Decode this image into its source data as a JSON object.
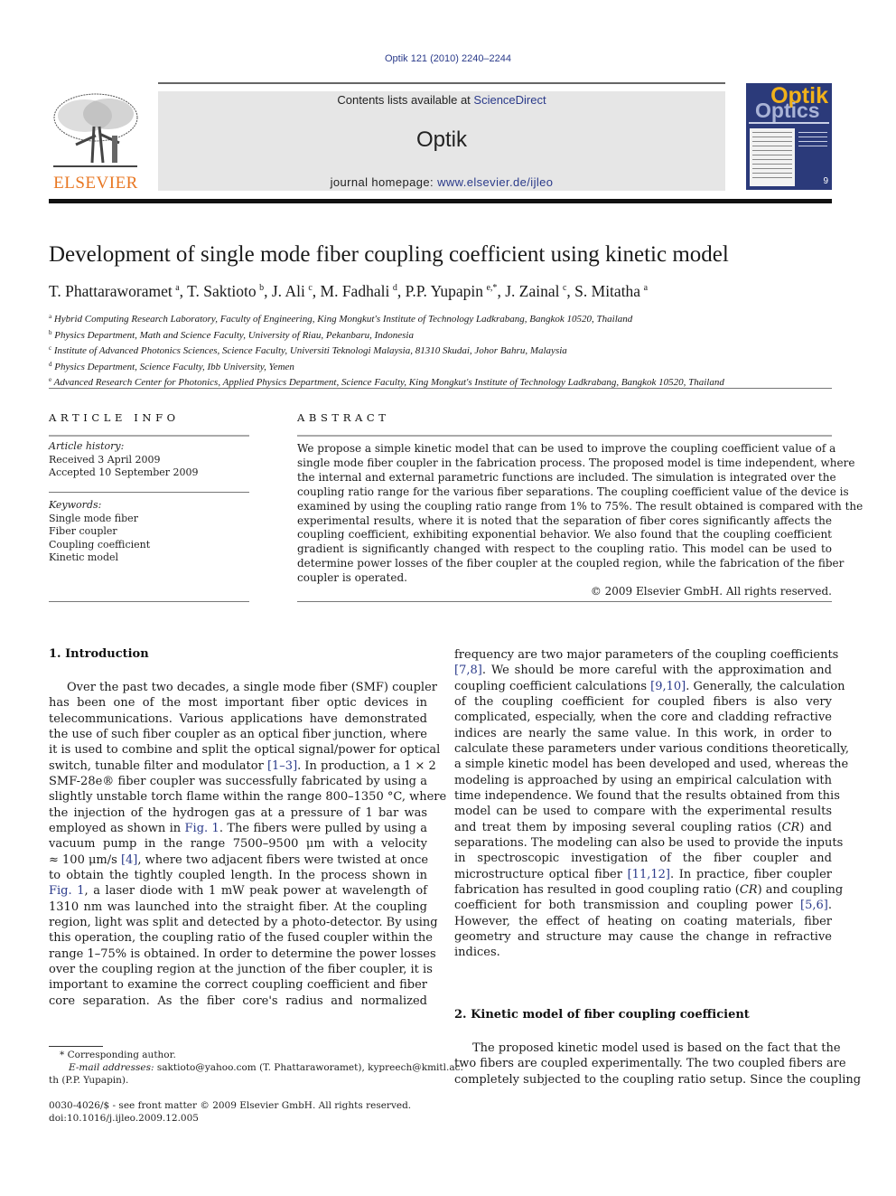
{
  "header": {
    "citation": "Optik 121 (2010) 2240–2244",
    "contents_prefix": "Contents lists available at ",
    "contents_link": "ScienceDirect",
    "journal_name": "Optik",
    "homepage_prefix": "journal homepage: ",
    "homepage_link": "www.elsevier.de/ijleo",
    "publisher_logo_text": "ELSEVIER",
    "cover": {
      "title_top": "Optik",
      "title_bottom": "Optics",
      "issue": "9"
    }
  },
  "colors": {
    "link": "#2a3a8a",
    "elsevier_orange": "#e87722",
    "cover_blue": "#2b3a7a",
    "cover_yellow": "#f1b21a",
    "banner_grey": "#e6e6e6"
  },
  "article": {
    "title": "Development of single mode fiber coupling coefficient using kinetic model",
    "authors": [
      {
        "name": "T. Phattaraworamet",
        "sup": "a",
        "sep": ", "
      },
      {
        "name": "T. Saktioto",
        "sup": "b",
        "sep": ", "
      },
      {
        "name": "J. Ali",
        "sup": "c",
        "sep": ", "
      },
      {
        "name": "M. Fadhali",
        "sup": "d",
        "sep": ", "
      },
      {
        "name": "P.P. Yupapin",
        "sup": "e,*",
        "sep": ", "
      },
      {
        "name": "J. Zainal",
        "sup": "c",
        "sep": ", "
      },
      {
        "name": "S. Mitatha",
        "sup": "a",
        "sep": ""
      }
    ],
    "affiliations": [
      {
        "key": "a",
        "text": "Hybrid Computing Research Laboratory, Faculty of Engineering, King Mongkut's Institute of Technology Ladkrabang, Bangkok 10520, Thailand"
      },
      {
        "key": "b",
        "text": "Physics Department, Math and Science Faculty, University of Riau, Pekanbaru, Indonesia"
      },
      {
        "key": "c",
        "text": "Institute of Advanced Photonics Sciences, Science Faculty, Universiti Teknologi Malaysia, 81310 Skudai, Johor Bahru, Malaysia"
      },
      {
        "key": "d",
        "text": "Physics Department, Science Faculty, Ibb University, Yemen"
      },
      {
        "key": "e",
        "text": "Advanced Research Center for Photonics, Applied Physics Department, Science Faculty, King Mongkut's Institute of Technology Ladkrabang, Bangkok 10520, Thailand"
      }
    ]
  },
  "article_info": {
    "heading": "ARTICLE INFO",
    "history_label": "Article history:",
    "received": "Received 3 April 2009",
    "accepted": "Accepted 10 September 2009",
    "keywords_label": "Keywords:",
    "keywords": [
      "Single mode fiber",
      "Fiber coupler",
      "Coupling coefficient",
      "Kinetic model"
    ]
  },
  "abstract": {
    "heading": "ABSTRACT",
    "lines": [
      "We propose a simple kinetic model that can be used to improve the coupling coefficient value of a",
      "single mode fiber coupler in the fabrication process. The proposed model is time independent, where",
      "the internal and external parametric functions are included. The simulation is integrated over the",
      "coupling ratio range for the various fiber separations. The coupling coefficient value of the device is",
      "examined by using the coupling ratio range from 1% to 75%. The result obtained is compared with the",
      "experimental results, where it is noted that the separation of fiber cores significantly affects the",
      "coupling coefficient, exhibiting exponential behavior. We also found that the coupling coefficient",
      "gradient is significantly changed with respect to the coupling ratio. This model can be used to",
      "determine power losses of the fiber coupler at the coupled region, while the fabrication of the fiber",
      "coupler is operated."
    ],
    "copyright": "© 2009 Elsevier GmbH. All rights reserved."
  },
  "section1": {
    "heading": "1.  Introduction",
    "col1_lines": [
      [
        {
          "t": "Over the past two decades, a single mode fiber (SMF) coupler"
        }
      ],
      [
        {
          "t": "has been one of the most important fiber optic devices in"
        }
      ],
      [
        {
          "t": "telecommunications. Various applications have demonstrated"
        }
      ],
      [
        {
          "t": "the use of such fiber coupler as an optical fiber junction, where"
        }
      ],
      [
        {
          "t": "it is used to combine and split the optical signal/power for optical"
        }
      ],
      [
        {
          "t": "switch, tunable filter and modulator "
        },
        {
          "t": "[1–3]",
          "ref": true
        },
        {
          "t": ". In production, a 1 × 2"
        }
      ],
      [
        {
          "t": "SMF-28e® fiber coupler was successfully fabricated by using a"
        }
      ],
      [
        {
          "t": "slightly unstable torch flame within the range 800–1350 °C, where"
        }
      ],
      [
        {
          "t": "the injection of the hydrogen gas at a pressure of 1 bar was"
        }
      ],
      [
        {
          "t": "employed as shown in "
        },
        {
          "t": "Fig. 1",
          "ref": true
        },
        {
          "t": ". The fibers were pulled by using a"
        }
      ],
      [
        {
          "t": "vacuum pump in the range 7500–9500 μm with a velocity"
        }
      ],
      [
        {
          "t": "≈ 100 μm/s "
        },
        {
          "t": "[4]",
          "ref": true
        },
        {
          "t": ", where two adjacent fibers were twisted at once"
        }
      ],
      [
        {
          "t": "to obtain the tightly coupled length. In the process shown in"
        }
      ],
      [
        {
          "t": "Fig. 1",
          "ref": true
        },
        {
          "t": ", a laser diode with 1 mW peak power at wavelength of"
        }
      ],
      [
        {
          "t": "1310 nm was launched into the straight fiber. At the coupling"
        }
      ],
      [
        {
          "t": "region, light was split and detected by a photo-detector. By using"
        }
      ],
      [
        {
          "t": "this operation, the coupling ratio of the fused coupler within the"
        }
      ],
      [
        {
          "t": "range 1–75% is obtained. In order to determine the power losses"
        }
      ],
      [
        {
          "t": "over the coupling region at the junction of the fiber coupler, it is"
        }
      ],
      [
        {
          "t": "important to examine the correct coupling coefficient and fiber"
        }
      ],
      [
        {
          "t": "core separation. As the fiber core's radius and normalized"
        }
      ]
    ],
    "col2_lines": [
      [
        {
          "t": "frequency are two major parameters of the coupling coefficients"
        }
      ],
      [
        {
          "t": "[7,8]",
          "ref": true
        },
        {
          "t": ". We should be more careful with the approximation and"
        }
      ],
      [
        {
          "t": "coupling coefficient calculations "
        },
        {
          "t": "[9,10]",
          "ref": true
        },
        {
          "t": ". Generally, the calculation"
        }
      ],
      [
        {
          "t": "of the coupling coefficient for coupled fibers is also very"
        }
      ],
      [
        {
          "t": "complicated, especially, when the core and cladding refractive"
        }
      ],
      [
        {
          "t": "indices are nearly the same value. In this work, in order to"
        }
      ],
      [
        {
          "t": "calculate these parameters under various conditions theoretically,"
        }
      ],
      [
        {
          "t": "a simple kinetic model has been developed and used, whereas the"
        }
      ],
      [
        {
          "t": "modeling is approached by using an empirical calculation with"
        }
      ],
      [
        {
          "t": "time independence. We found that the results obtained from this"
        }
      ],
      [
        {
          "t": "model can be used to compare with the experimental results"
        }
      ],
      [
        {
          "t": "and treat them by imposing several coupling ratios ("
        },
        {
          "t": "CR",
          "it": true
        },
        {
          "t": ") and"
        }
      ],
      [
        {
          "t": "separations. The modeling can also be used to provide the inputs"
        }
      ],
      [
        {
          "t": "in spectroscopic investigation of the fiber coupler and"
        }
      ],
      [
        {
          "t": "microstructure optical fiber "
        },
        {
          "t": "[11,12]",
          "ref": true
        },
        {
          "t": ". In practice, fiber coupler"
        }
      ],
      [
        {
          "t": "fabrication has resulted in good coupling ratio ("
        },
        {
          "t": "CR",
          "it": true
        },
        {
          "t": ") and coupling"
        }
      ],
      [
        {
          "t": "coefficient for both transmission and coupling power "
        },
        {
          "t": "[5,6]",
          "ref": true
        },
        {
          "t": "."
        }
      ],
      [
        {
          "t": "However, the effect of heating on coating materials, fiber"
        }
      ],
      [
        {
          "t": "geometry and structure may cause the change in refractive"
        }
      ],
      [
        {
          "t": "indices."
        }
      ]
    ]
  },
  "section2": {
    "heading": "2.  Kinetic model of fiber coupling coefficient",
    "lines": [
      [
        {
          "t": "The proposed kinetic model used is based on the fact that the"
        }
      ],
      [
        {
          "t": "two fibers are coupled experimentally. The two coupled fibers are"
        }
      ],
      [
        {
          "t": "completely subjected to the coupling ratio setup. Since the coupling"
        }
      ]
    ]
  },
  "footnotes": {
    "corresponding": "* Corresponding author.",
    "email_label": "E-mail addresses:",
    "email_line1": " saktioto@yahoo.com (T. Phattaraworamet), kypreech@kmitl.ac.",
    "email_line2": "th (P.P. Yupapin).",
    "front_matter": "0030-4026/$ - see front matter © 2009 Elsevier GmbH. All rights reserved.",
    "doi": "doi:10.1016/j.ijleo.2009.12.005"
  }
}
